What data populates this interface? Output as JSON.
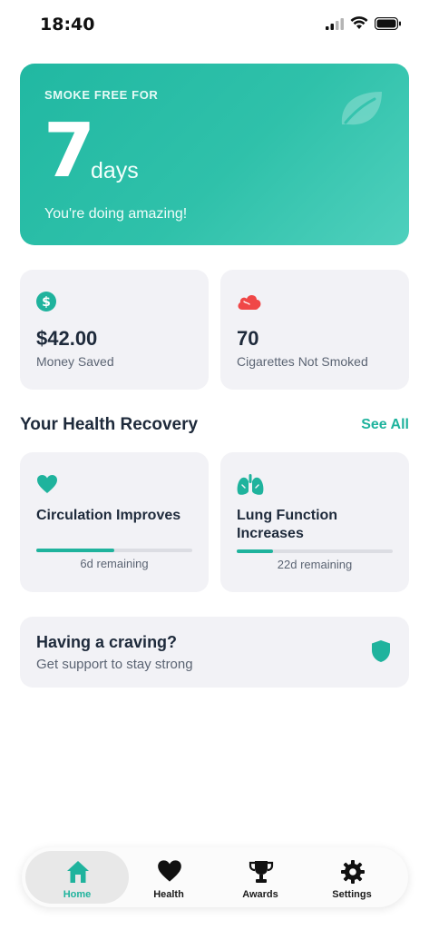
{
  "status_bar": {
    "time": "18:40"
  },
  "hero": {
    "label": "SMOKE FREE FOR",
    "number": "7",
    "unit": "days",
    "message": "You're doing amazing!",
    "icon": "leaf-icon",
    "gradient": [
      "#21b8a2",
      "#4fd0bd"
    ]
  },
  "stats": [
    {
      "icon": "dollar-icon",
      "value": "$42.00",
      "label": "Money Saved"
    },
    {
      "icon": "smoke-cloud-icon",
      "value": "70",
      "label": "Cigarettes Not Smoked"
    }
  ],
  "health": {
    "title": "Your Health Recovery",
    "see_all": "See All",
    "items": [
      {
        "icon": "heart-icon",
        "title": "Circulation Improves",
        "remaining": "6d remaining",
        "progress": 0.5
      },
      {
        "icon": "lungs-icon",
        "title": "Lung Function Increases",
        "remaining": "22d remaining",
        "progress": 0.23
      }
    ]
  },
  "craving": {
    "title": "Having a craving?",
    "subtitle": "Get support to stay strong",
    "icon": "shield-icon"
  },
  "tabs": [
    {
      "label": "Home",
      "icon": "home-icon",
      "active": true
    },
    {
      "label": "Health",
      "icon": "heart-icon",
      "active": false
    },
    {
      "label": "Awards",
      "icon": "trophy-icon",
      "active": false
    },
    {
      "label": "Settings",
      "icon": "gear-icon",
      "active": false
    }
  ],
  "colors": {
    "accent": "#1fb39d",
    "card_bg": "#f2f2f6",
    "danger": "#f04747",
    "text_dark": "#1e2a3b",
    "text_muted": "#5b6473"
  }
}
